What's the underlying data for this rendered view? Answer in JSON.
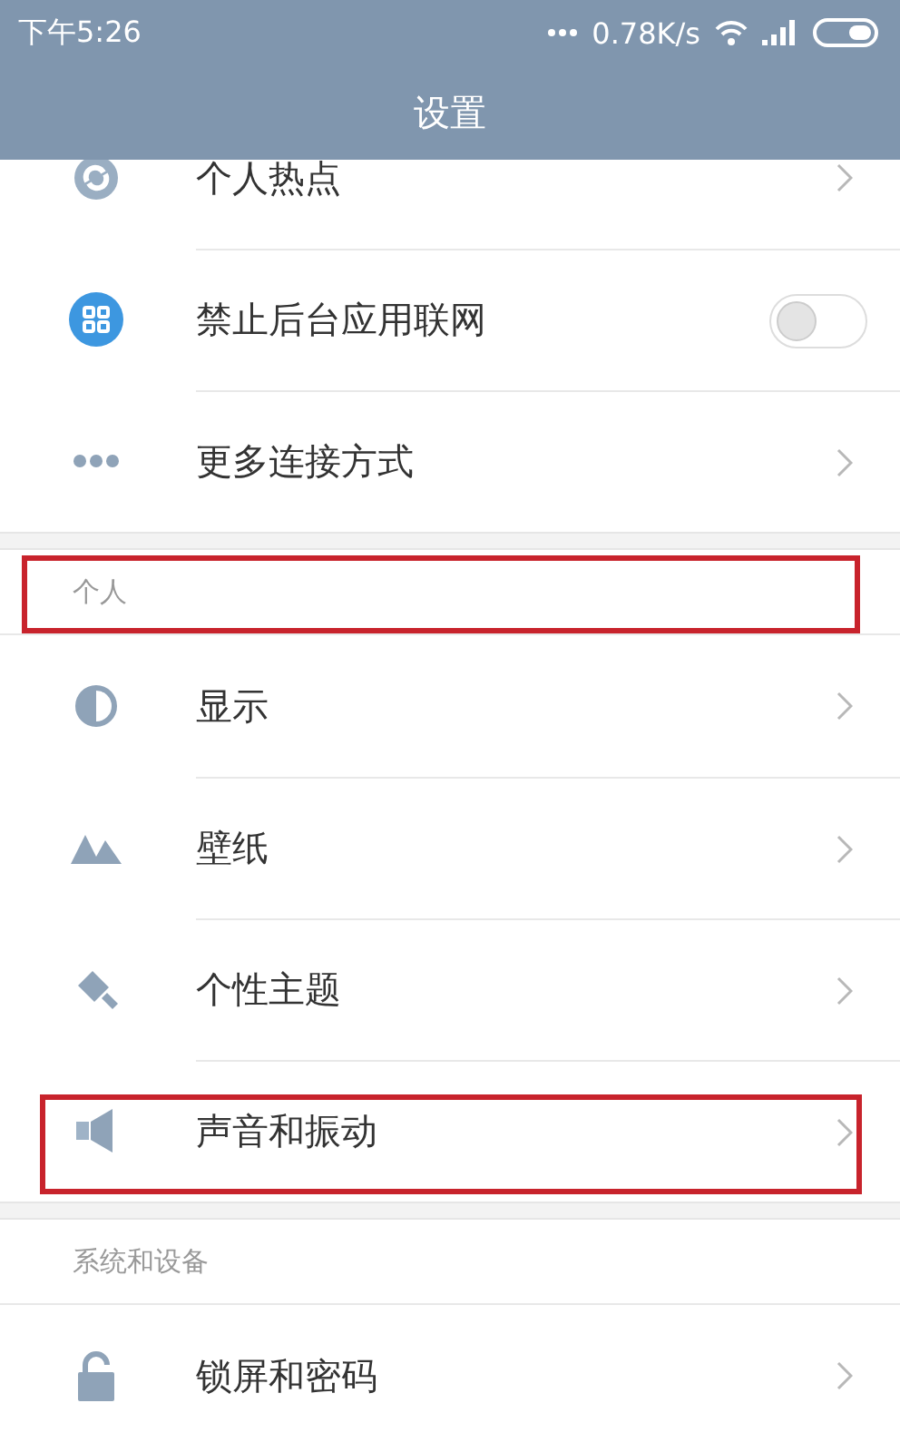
{
  "status_bar": {
    "time": "下午5:26",
    "speed": "0.78K/s"
  },
  "header": {
    "title": "设置"
  },
  "groups": [
    {
      "items": [
        {
          "label": "个人热点",
          "kind": "link",
          "highlighted": false
        },
        {
          "label": "禁止后台应用联网",
          "kind": "toggle",
          "on": false,
          "highlighted": false
        },
        {
          "label": "更多连接方式",
          "kind": "link",
          "highlighted": false
        }
      ]
    },
    {
      "title": "个人",
      "highlighted": true,
      "items": [
        {
          "label": "显示",
          "kind": "link",
          "highlighted": false
        },
        {
          "label": "壁纸",
          "kind": "link",
          "highlighted": false
        },
        {
          "label": "个性主题",
          "kind": "link",
          "highlighted": false
        },
        {
          "label": "声音和振动",
          "kind": "link",
          "highlighted": true
        }
      ]
    },
    {
      "title": "系统和设备",
      "highlighted": false,
      "items": [
        {
          "label": "锁屏和密码",
          "kind": "link",
          "highlighted": false
        }
      ]
    }
  ]
}
